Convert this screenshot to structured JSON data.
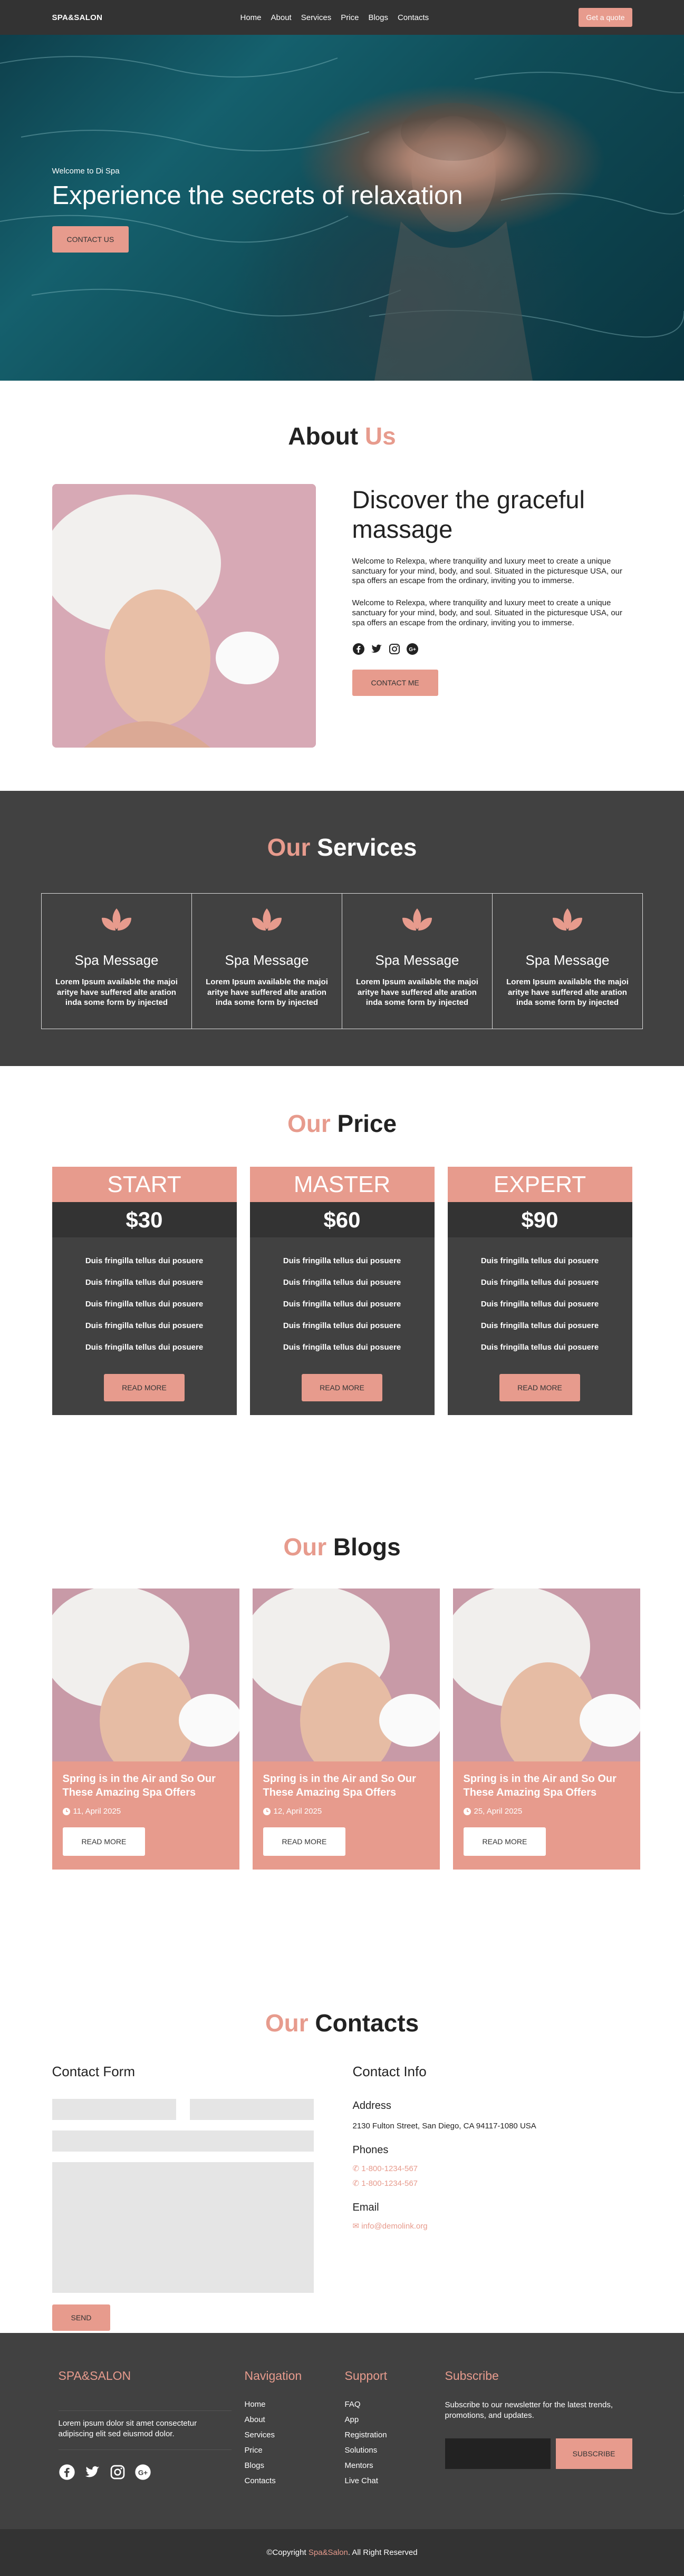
{
  "nav": {
    "brand": "SPA&SALON",
    "items": [
      "Home",
      "About",
      "Services",
      "Price",
      "Blogs",
      "Contacts"
    ],
    "cta": "Get a quote"
  },
  "hero": {
    "eyebrow": "Welcome to Di Spa",
    "title": "Experience the secrets of relaxation",
    "button": "CONTACT US"
  },
  "about": {
    "title_a": "About",
    "title_b": "Us",
    "heading": "Discover the graceful massage",
    "para1": "Welcome to Relexpa, where tranquility and luxury meet to create a unique sanctuary for your mind, body, and soul. Situated in the picturesque USA, our spa offers an escape from the ordinary, inviting you to immerse.",
    "para2": "Welcome to Relexpa, where tranquility and luxury meet to create a unique sanctuary for your mind, body, and soul. Situated in the picturesque USA, our spa offers an escape from the ordinary, inviting you to immerse.",
    "button": "CONTACT ME",
    "socials": [
      "facebook-icon",
      "twitter-icon",
      "instagram-icon",
      "google-plus-icon"
    ]
  },
  "services": {
    "title_a": "Our",
    "title_b": "Services",
    "items": [
      {
        "name": "Spa Message",
        "desc": "Lorem Ipsum available the majoi aritye have suffered alte aration inda some form by injected"
      },
      {
        "name": "Spa Message",
        "desc": "Lorem Ipsum available the majoi aritye have suffered alte aration inda some form by injected"
      },
      {
        "name": "Spa Message",
        "desc": "Lorem Ipsum available the majoi aritye have suffered alte aration inda some form by injected"
      },
      {
        "name": "Spa Message",
        "desc": "Lorem Ipsum available the majoi aritye have suffered alte aration inda some form by injected"
      }
    ]
  },
  "price": {
    "title_a": "Our",
    "title_b": "Price",
    "plans": [
      {
        "name": "START",
        "price": "$30",
        "features": [
          "Duis fringilla tellus dui posuere",
          "Duis fringilla tellus dui posuere",
          "Duis fringilla tellus dui posuere",
          "Duis fringilla tellus dui posuere",
          "Duis fringilla tellus dui posuere"
        ],
        "button": "READ MORE"
      },
      {
        "name": "MASTER",
        "price": "$60",
        "features": [
          "Duis fringilla tellus dui posuere",
          "Duis fringilla tellus dui posuere",
          "Duis fringilla tellus dui posuere",
          "Duis fringilla tellus dui posuere",
          "Duis fringilla tellus dui posuere"
        ],
        "button": "READ MORE"
      },
      {
        "name": "EXPERT",
        "price": "$90",
        "features": [
          "Duis fringilla tellus dui posuere",
          "Duis fringilla tellus dui posuere",
          "Duis fringilla tellus dui posuere",
          "Duis fringilla tellus dui posuere",
          "Duis fringilla tellus dui posuere"
        ],
        "button": "READ MORE"
      }
    ]
  },
  "blogs": {
    "title_a": "Our",
    "title_b": "Blogs",
    "posts": [
      {
        "title": "Spring is in the Air and So Our These Amazing Spa Offers",
        "date": "11, April 2025",
        "button": "READ MORE"
      },
      {
        "title": "Spring is in the Air and So Our These Amazing Spa Offers",
        "date": "12, April 2025",
        "button": "READ MORE"
      },
      {
        "title": "Spring is in the Air and So Our These Amazing Spa Offers",
        "date": "25, April 2025",
        "button": "READ MORE"
      }
    ]
  },
  "contacts": {
    "title_a": "Our",
    "title_b": "Contacts",
    "form_title": "Contact Form",
    "send": "SEND",
    "info_title": "Contact Info",
    "address_label": "Address",
    "address": "2130 Fulton Street, San Diego, CA 94117-1080 USA",
    "phones_label": "Phones",
    "phone1": "1-800-1234-567",
    "phone2": "1-800-1234-567",
    "email_label": "Email",
    "email": "info@demolink.org"
  },
  "footer": {
    "brand": "SPA&SALON",
    "about": "Lorem ipsum dolor sit amet consectetur adipiscing elit sed eiusmod dolor.",
    "nav_title": "Navigation",
    "nav_items": [
      "Home",
      "About",
      "Services",
      "Price",
      "Blogs",
      "Contacts"
    ],
    "support_title": "Support",
    "support_items": [
      "FAQ",
      "App",
      "Registration",
      "Solutions",
      "Mentors",
      "Live Chat"
    ],
    "subscribe_title": "Subscribe",
    "subscribe_text": "Subscribe to our newsletter for the latest trends, promotions, and updates.",
    "subscribe_button": "SUBSCRIBE",
    "copy_prefix": "©Copyright",
    "copy_brand": "Spa&Salon",
    "copy_suffix": ". All Right Reserved"
  },
  "colors": {
    "accent": "#e79b8d",
    "dark": "#414141",
    "darker": "#333333"
  }
}
